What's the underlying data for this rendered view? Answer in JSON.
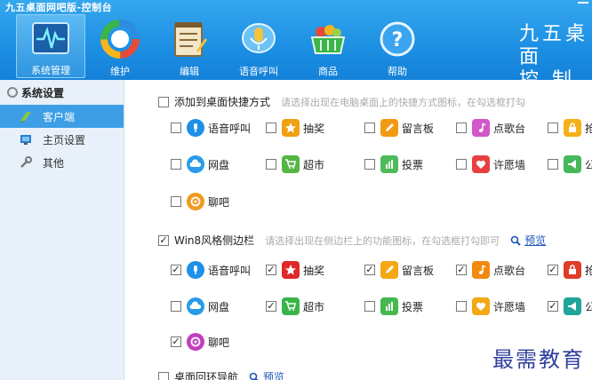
{
  "window": {
    "title": "九五桌面网吧版-控制台"
  },
  "toolbar": {
    "items": [
      {
        "label": "系统管理",
        "icon": "pulse-monitor-icon",
        "active": true
      },
      {
        "label": "维护",
        "icon": "maintenance-ring-icon"
      },
      {
        "label": "编辑",
        "icon": "notepad-icon"
      },
      {
        "label": "语音呼叫",
        "icon": "microphone-icon"
      },
      {
        "label": "商品",
        "icon": "shopping-basket-icon"
      },
      {
        "label": "帮助",
        "icon": "help-icon"
      }
    ]
  },
  "brand": {
    "line1": "九五桌面",
    "line2": "控 制 台"
  },
  "sidebar": {
    "heading": "系统设置",
    "items": [
      {
        "label": "客户端",
        "active": true
      },
      {
        "label": "主页设置"
      },
      {
        "label": "其他"
      }
    ]
  },
  "sections": {
    "shortcut": {
      "label": "添加到桌面快捷方式",
      "hint": "请选择出现在电脑桌面上的快捷方式图标，在勾选框打勾",
      "checked": false,
      "items": [
        {
          "label": "语音呼叫",
          "checked": false,
          "color": "#1e90e8",
          "icon": "microphone-icon"
        },
        {
          "label": "抽奖",
          "checked": false,
          "color": "#f0a010",
          "icon": "star-icon"
        },
        {
          "label": "留言板",
          "checked": false,
          "color": "#f29a12",
          "icon": "pencil-icon"
        },
        {
          "label": "点歌台",
          "checked": false,
          "color": "#d257c8",
          "icon": "music-icon"
        },
        {
          "label": "抢",
          "checked": false,
          "color": "#f5b01a",
          "icon": "lock-icon"
        },
        {
          "label": "网盘",
          "checked": false,
          "color": "#2a9be8",
          "icon": "cloud-icon"
        },
        {
          "label": "超市",
          "checked": false,
          "color": "#55b545",
          "icon": "cart-icon"
        },
        {
          "label": "投票",
          "checked": false,
          "color": "#4dbb5a",
          "icon": "bar-chart-icon"
        },
        {
          "label": "许愿墙",
          "checked": false,
          "color": "#e84040",
          "icon": "heart-icon"
        },
        {
          "label": "公",
          "checked": false,
          "color": "#45b85a",
          "icon": "megaphone-icon"
        },
        {
          "label": "聊吧",
          "checked": false,
          "color": "#f09a20",
          "icon": "chat-icon"
        }
      ]
    },
    "win8": {
      "label": "Win8风格侧边栏",
      "hint": "请选择出现在侧边栏上的功能图标，在勾选框打勾即可",
      "preview_label": "预览",
      "checked": true,
      "items": [
        {
          "label": "语音呼叫",
          "checked": true,
          "color": "#1e90e8",
          "icon": "microphone-icon"
        },
        {
          "label": "抽奖",
          "checked": true,
          "color": "#e02828",
          "icon": "star-icon"
        },
        {
          "label": "留言板",
          "checked": true,
          "color": "#f5a815",
          "icon": "pencil-icon"
        },
        {
          "label": "点歌台",
          "checked": true,
          "color": "#f28a10",
          "icon": "music-icon"
        },
        {
          "label": "抢",
          "checked": true,
          "color": "#e03c28",
          "icon": "lock-icon"
        },
        {
          "label": "网盘",
          "checked": false,
          "color": "#2a9be8",
          "icon": "cloud-icon"
        },
        {
          "label": "超市",
          "checked": true,
          "color": "#3bb54a",
          "icon": "cart-icon"
        },
        {
          "label": "投票",
          "checked": false,
          "color": "#45b84f",
          "icon": "bar-chart-icon"
        },
        {
          "label": "许愿墙",
          "checked": false,
          "color": "#f5a815",
          "icon": "heart-icon"
        },
        {
          "label": "公",
          "checked": true,
          "color": "#1fa59a",
          "icon": "megaphone-icon"
        },
        {
          "label": "聊吧",
          "checked": true,
          "color": "#c23fbf",
          "icon": "chat-icon"
        }
      ]
    },
    "loopnav": {
      "label": "桌面回环导航",
      "preview_label": "预览",
      "checked": false
    }
  },
  "watermark": "最需教育"
}
